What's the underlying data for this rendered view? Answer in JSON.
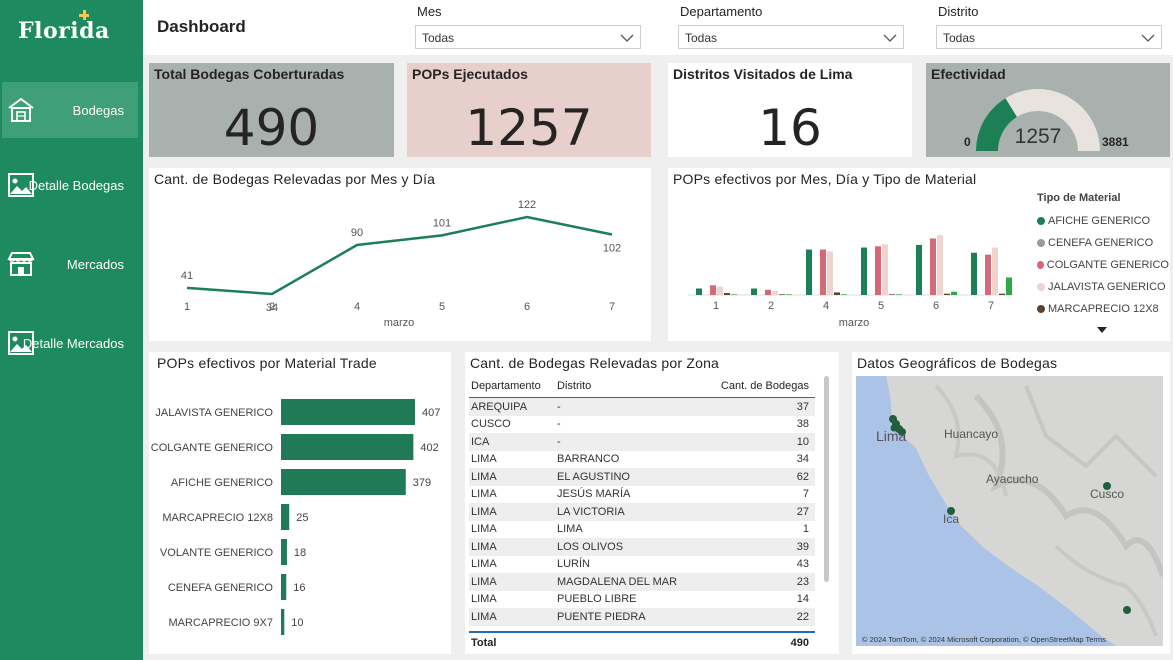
{
  "sidebar": {
    "logo": "Florida",
    "items": [
      {
        "label": "Bodegas"
      },
      {
        "label": "Detalle Bodegas"
      },
      {
        "label": "Mercados"
      },
      {
        "label": "Detalle Mercados"
      }
    ]
  },
  "header": {
    "title": "Dashboard",
    "slicers": [
      {
        "label": "Mes",
        "value": "Todas"
      },
      {
        "label": "Departamento",
        "value": "Todas"
      },
      {
        "label": "Distrito",
        "value": "Todas"
      }
    ]
  },
  "kpis": {
    "bodegas": {
      "title": "Total Bodegas Coberturadas",
      "value": "490"
    },
    "pops": {
      "title": "POPs Ejecutados",
      "value": "1257"
    },
    "distritos": {
      "title": "Distritos Visitados de Lima",
      "value": "16"
    },
    "efectividad": {
      "title": "Efectividad",
      "value": "1257",
      "min": "0",
      "max": "3881",
      "fraction": 0.324
    }
  },
  "colors": {
    "accent": "#1e8a5f",
    "bar_dark": "#217a57",
    "kpi_gray": "#a9b1af",
    "kpi_pink": "#e7d0cb",
    "afiche": "#1d7f55",
    "cenefa": "#9b9b9b",
    "colgante": "#d46a78",
    "jalavista": "#efd3cf",
    "marcaprecio": "#5b4331"
  },
  "chart_data": [
    {
      "type": "line",
      "title": "Cant. de Bodegas Relevadas por Mes y Día",
      "xlabel": "marzo",
      "ylabel": "",
      "x": [
        "1",
        "2",
        "4",
        "5",
        "6",
        "7"
      ],
      "series": [
        {
          "values": [
            41,
            34,
            90,
            101,
            122,
            102
          ]
        }
      ]
    },
    {
      "type": "bar",
      "title": "POPs efectivos por Mes, Día y Tipo de Material",
      "xlabel": "marzo",
      "legend_title": "Tipo de Material",
      "legend_position": "right",
      "categories": [
        "1",
        "2",
        "4",
        "5",
        "6",
        "7"
      ],
      "series": [
        {
          "name": "AFICHE GENERICO",
          "values": [
            10,
            10,
            70,
            73,
            77,
            65
          ]
        },
        {
          "name": "CENEFA GENERICO",
          "values": [
            0,
            0,
            0,
            0,
            0,
            0
          ]
        },
        {
          "name": "COLGANTE GENERICO",
          "values": [
            15,
            8,
            70,
            75,
            87,
            62
          ]
        },
        {
          "name": "JALAVISTA GENERICO",
          "values": [
            13,
            6,
            67,
            78,
            92,
            73
          ]
        },
        {
          "name": "MARCAPRECIO 12X8",
          "values": [
            3,
            1,
            4,
            1,
            2,
            2
          ]
        },
        {
          "name": "",
          "values": [
            1,
            1,
            1,
            1,
            5,
            27
          ]
        }
      ]
    },
    {
      "type": "bar",
      "orientation": "horizontal",
      "title": "POPs efectivos por Material Trade",
      "categories": [
        "JALAVISTA GENERICO",
        "COLGANTE GENERICO",
        "AFICHE GENERICO",
        "MARCAPRECIO 12X8",
        "VOLANTE GENERICO",
        "CENEFA GENERICO",
        "MARCAPRECIO 9X7"
      ],
      "values": [
        407,
        402,
        379,
        25,
        18,
        16,
        10
      ]
    },
    {
      "type": "table",
      "title": "Cant. de Bodegas Relevadas por Zona",
      "columns": [
        "Departamento",
        "Distrito",
        "Cant. de Bodegas"
      ],
      "rows": [
        [
          "AREQUIPA",
          "-",
          "37"
        ],
        [
          "CUSCO",
          "-",
          "38"
        ],
        [
          "ICA",
          "-",
          "10"
        ],
        [
          "LIMA",
          "BARRANCO",
          "34"
        ],
        [
          "LIMA",
          "EL AGUSTINO",
          "62"
        ],
        [
          "LIMA",
          "JESÚS MARÍA",
          "7"
        ],
        [
          "LIMA",
          "LA VICTORIA",
          "27"
        ],
        [
          "LIMA",
          "LIMA",
          "1"
        ],
        [
          "LIMA",
          "LOS OLIVOS",
          "39"
        ],
        [
          "LIMA",
          "LURÍN",
          "43"
        ],
        [
          "LIMA",
          "MAGDALENA DEL MAR",
          "23"
        ],
        [
          "LIMA",
          "PUEBLO LIBRE",
          "14"
        ],
        [
          "LIMA",
          "PUENTE PIEDRA",
          "22"
        ]
      ],
      "total": [
        "Total",
        "",
        "490"
      ]
    }
  ],
  "map": {
    "title": "Datos Geográficos de Bodegas",
    "labels": {
      "lima": "Lima",
      "huancayo": "Huancayo",
      "ayacucho": "Ayacucho",
      "ica": "Ica",
      "cusco": "Cusco"
    },
    "credit": "© 2024 TomTom, © 2024 Microsoft Corporation, © OpenStreetMap  Terms"
  }
}
